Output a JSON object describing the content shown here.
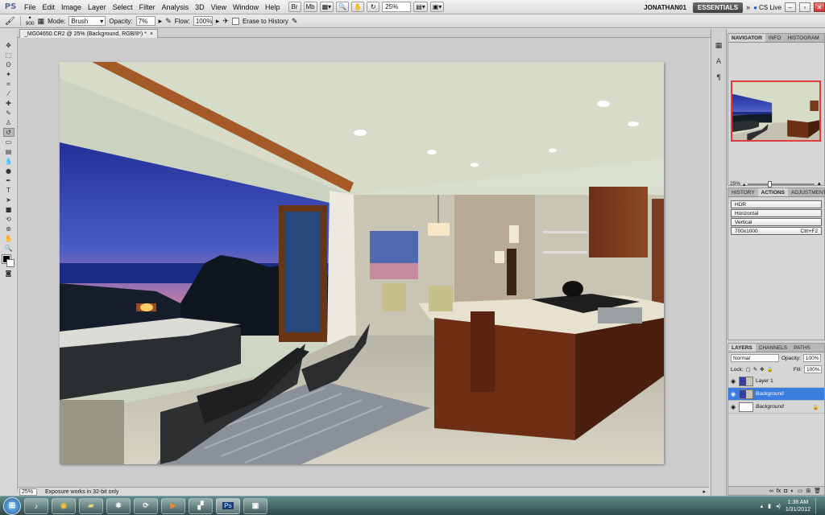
{
  "app": {
    "logo": "PS"
  },
  "menubar": {
    "items": [
      "File",
      "Edit",
      "Image",
      "Layer",
      "Select",
      "Filter",
      "Analysis",
      "3D",
      "View",
      "Window",
      "Help"
    ],
    "zoom": "25%",
    "workspace_user": "JONATHAN01",
    "workspace": "ESSENTIALS",
    "cs_live": "CS Live"
  },
  "options": {
    "brush_size": "900",
    "mode_label": "Mode:",
    "mode_value": "Brush",
    "opacity_label": "Opacity:",
    "opacity_value": "7%",
    "flow_label": "Flow:",
    "flow_value": "100%",
    "erase_label": "Erase to History"
  },
  "document": {
    "tab_title": "_MG04650.CR2 @ 25% (Background, RGB/8*) *",
    "tab_close": "×"
  },
  "status": {
    "zoom": "25%",
    "message": "Exposure works in 32-bit only"
  },
  "navigator": {
    "tabs": [
      "NAVIGATOR",
      "INFO",
      "HISTOGRAM"
    ],
    "zoom": "25%"
  },
  "actions": {
    "tabs": [
      "HISTORY",
      "ACTIONS",
      "ADJUSTMENT"
    ],
    "items": [
      {
        "label": "HDR",
        "shortcut": ""
      },
      {
        "label": "Horizontal",
        "shortcut": ""
      },
      {
        "label": "Vertical",
        "shortcut": ""
      },
      {
        "label": "700x1000",
        "shortcut": "Ctrl+F2"
      }
    ]
  },
  "layers": {
    "tabs": [
      "LAYERS",
      "CHANNELS",
      "PATHS"
    ],
    "blend_mode": "Normal",
    "opacity_label": "Opacity:",
    "opacity_value": "100%",
    "lock_label": "Lock:",
    "fill_label": "Fill:",
    "fill_value": "100%",
    "items": [
      {
        "name": "Layer 1",
        "selected": false
      },
      {
        "name": "Background",
        "selected": true
      },
      {
        "name": "Background",
        "selected": false
      }
    ]
  },
  "taskbar": {
    "apps": [
      "ie-icon",
      "chrome-icon",
      "explorer-icon",
      "media-icon",
      "connect-icon",
      "player-icon",
      "notes-icon",
      "photoshop-icon",
      "bridge-icon"
    ],
    "ps_label": "Ps",
    "time": "1:38 AM",
    "date": "1/31/2012"
  },
  "colors": {
    "accent": "#3a7de0",
    "sky_top": "#2b3fa8",
    "sky_bottom": "#e58aa0"
  }
}
